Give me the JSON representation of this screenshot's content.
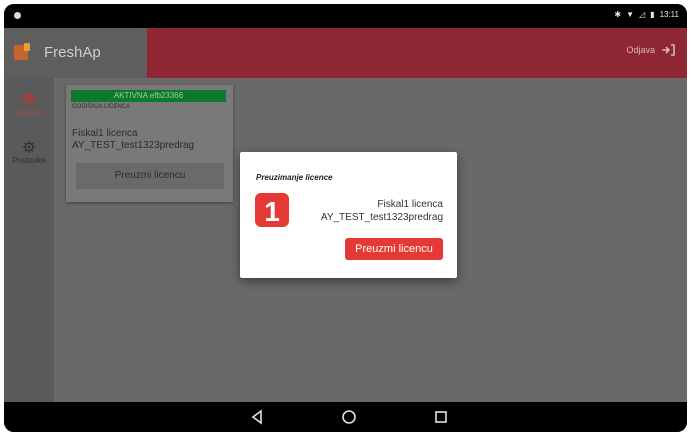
{
  "status_bar": {
    "time": "13:11"
  },
  "app": {
    "title": "FreshAp",
    "logout_label": "Odjava"
  },
  "sidebar": {
    "items": [
      {
        "label": "Licence",
        "icon": "layers-icon"
      },
      {
        "label": "Postavke",
        "icon": "gear-icon"
      }
    ]
  },
  "license_card": {
    "status": "AKTIVNA efb23366",
    "type": "GODIŠNJA LICENCA",
    "line1": "Fiskal1 licenca",
    "line2": "AY_TEST_test1323predrag",
    "button_label": "Preuzmi licencu"
  },
  "dialog": {
    "title": "Preuzimanje licence",
    "line1": "Fiskal1 licenca",
    "line2": "AY_TEST_test1323predrag",
    "button_label": "Preuzmi licencu",
    "logo_text": "1"
  },
  "colors": {
    "accent_red": "#e53935",
    "appbar_red": "#8e2733",
    "active_green": "#0b7a2e"
  }
}
